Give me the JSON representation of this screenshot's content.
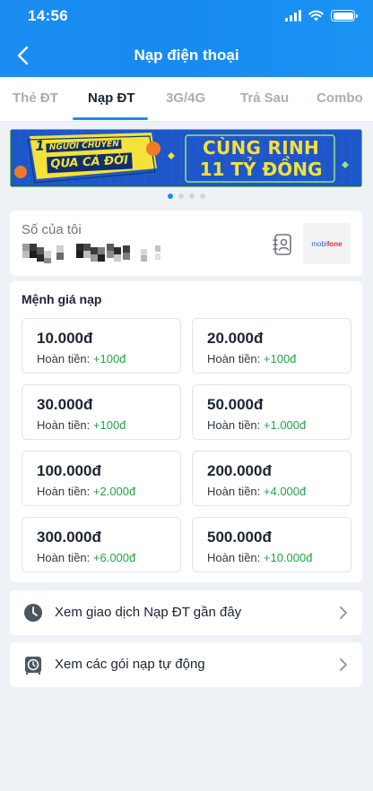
{
  "status_bar": {
    "time": "14:56"
  },
  "header": {
    "title": "Nạp điện thoại"
  },
  "tabs": [
    {
      "label": "Thẻ ĐT",
      "active": false
    },
    {
      "label": "Nạp ĐT",
      "active": true
    },
    {
      "label": "3G/4G",
      "active": false
    },
    {
      "label": "Trả Sau",
      "active": false
    },
    {
      "label": "Combo",
      "active": false
    }
  ],
  "banner": {
    "left_line1_num": "1",
    "left_line1": "NGƯỜI CHUYỂN",
    "left_line2": "QUA CẢ ĐỜI",
    "right_line1": "CÙNG RINH",
    "right_line2": "11 TỶ ĐỒNG",
    "slides": 4,
    "active_slide": 1
  },
  "phone": {
    "label": "Số của tôi",
    "operator": {
      "prefix": "mobi",
      "suffix": "fone"
    }
  },
  "denominations": {
    "title": "Mệnh giá nạp",
    "cashback_label": "Hoàn tiền:",
    "items": [
      {
        "amount": "10.000đ",
        "cashback": "+100đ"
      },
      {
        "amount": "20.000đ",
        "cashback": "+100đ"
      },
      {
        "amount": "30.000đ",
        "cashback": "+100đ"
      },
      {
        "amount": "50.000đ",
        "cashback": "+1.000đ"
      },
      {
        "amount": "100.000đ",
        "cashback": "+2.000đ"
      },
      {
        "amount": "200.000đ",
        "cashback": "+4.000đ"
      },
      {
        "amount": "300.000đ",
        "cashback": "+6.000đ"
      },
      {
        "amount": "500.000đ",
        "cashback": "+10.000đ"
      }
    ]
  },
  "links": [
    {
      "label": "Xem giao dịch Nạp ĐT gần đây",
      "icon": "clock-icon"
    },
    {
      "label": "Xem các gói nạp tự động",
      "icon": "auto-topup-icon"
    }
  ],
  "colors": {
    "brand_blue": "#1a8cf2",
    "cashback_green": "#22a447",
    "banner_blue": "#1d56c9",
    "banner_yellow": "#f5e13a"
  }
}
